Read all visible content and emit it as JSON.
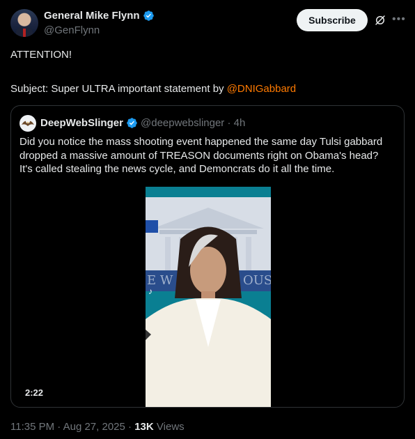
{
  "author": {
    "name": "General Mike Flynn",
    "handle": "@GenFlynn"
  },
  "actions": {
    "subscribe_label": "Subscribe"
  },
  "icons": {
    "verified": "verified-badge-icon",
    "grok": "grok-icon",
    "more": "more-icon"
  },
  "tweet": {
    "line1": "ATTENTION!",
    "line2_prefix": "Subject: Super ULTRA important statement by ",
    "mention": "@DNIGabbard"
  },
  "quote": {
    "name": "DeepWebSlinger",
    "handle": "@deepwebslinger",
    "separator": "·",
    "time": "4h",
    "text_lines": [
      "Did you notice the mass shooting event happened the same day Tulsi gabbard",
      "dropped a massive amount of TREASON documents right on Obama's head?",
      "It's called stealing the news cycle, and Demoncrats do it all the time."
    ],
    "video": {
      "duration": "2:22"
    }
  },
  "footer": {
    "time": "11:35 PM",
    "separator": "·",
    "date": "Aug 27, 2025",
    "views_count": "13K",
    "views_label": "Views"
  },
  "colors": {
    "background": "#000000",
    "text": "#e7e9ea",
    "muted": "#71767b",
    "mention": "#ff7a00",
    "verified": "#1d9bf0",
    "border": "#2f3336"
  }
}
